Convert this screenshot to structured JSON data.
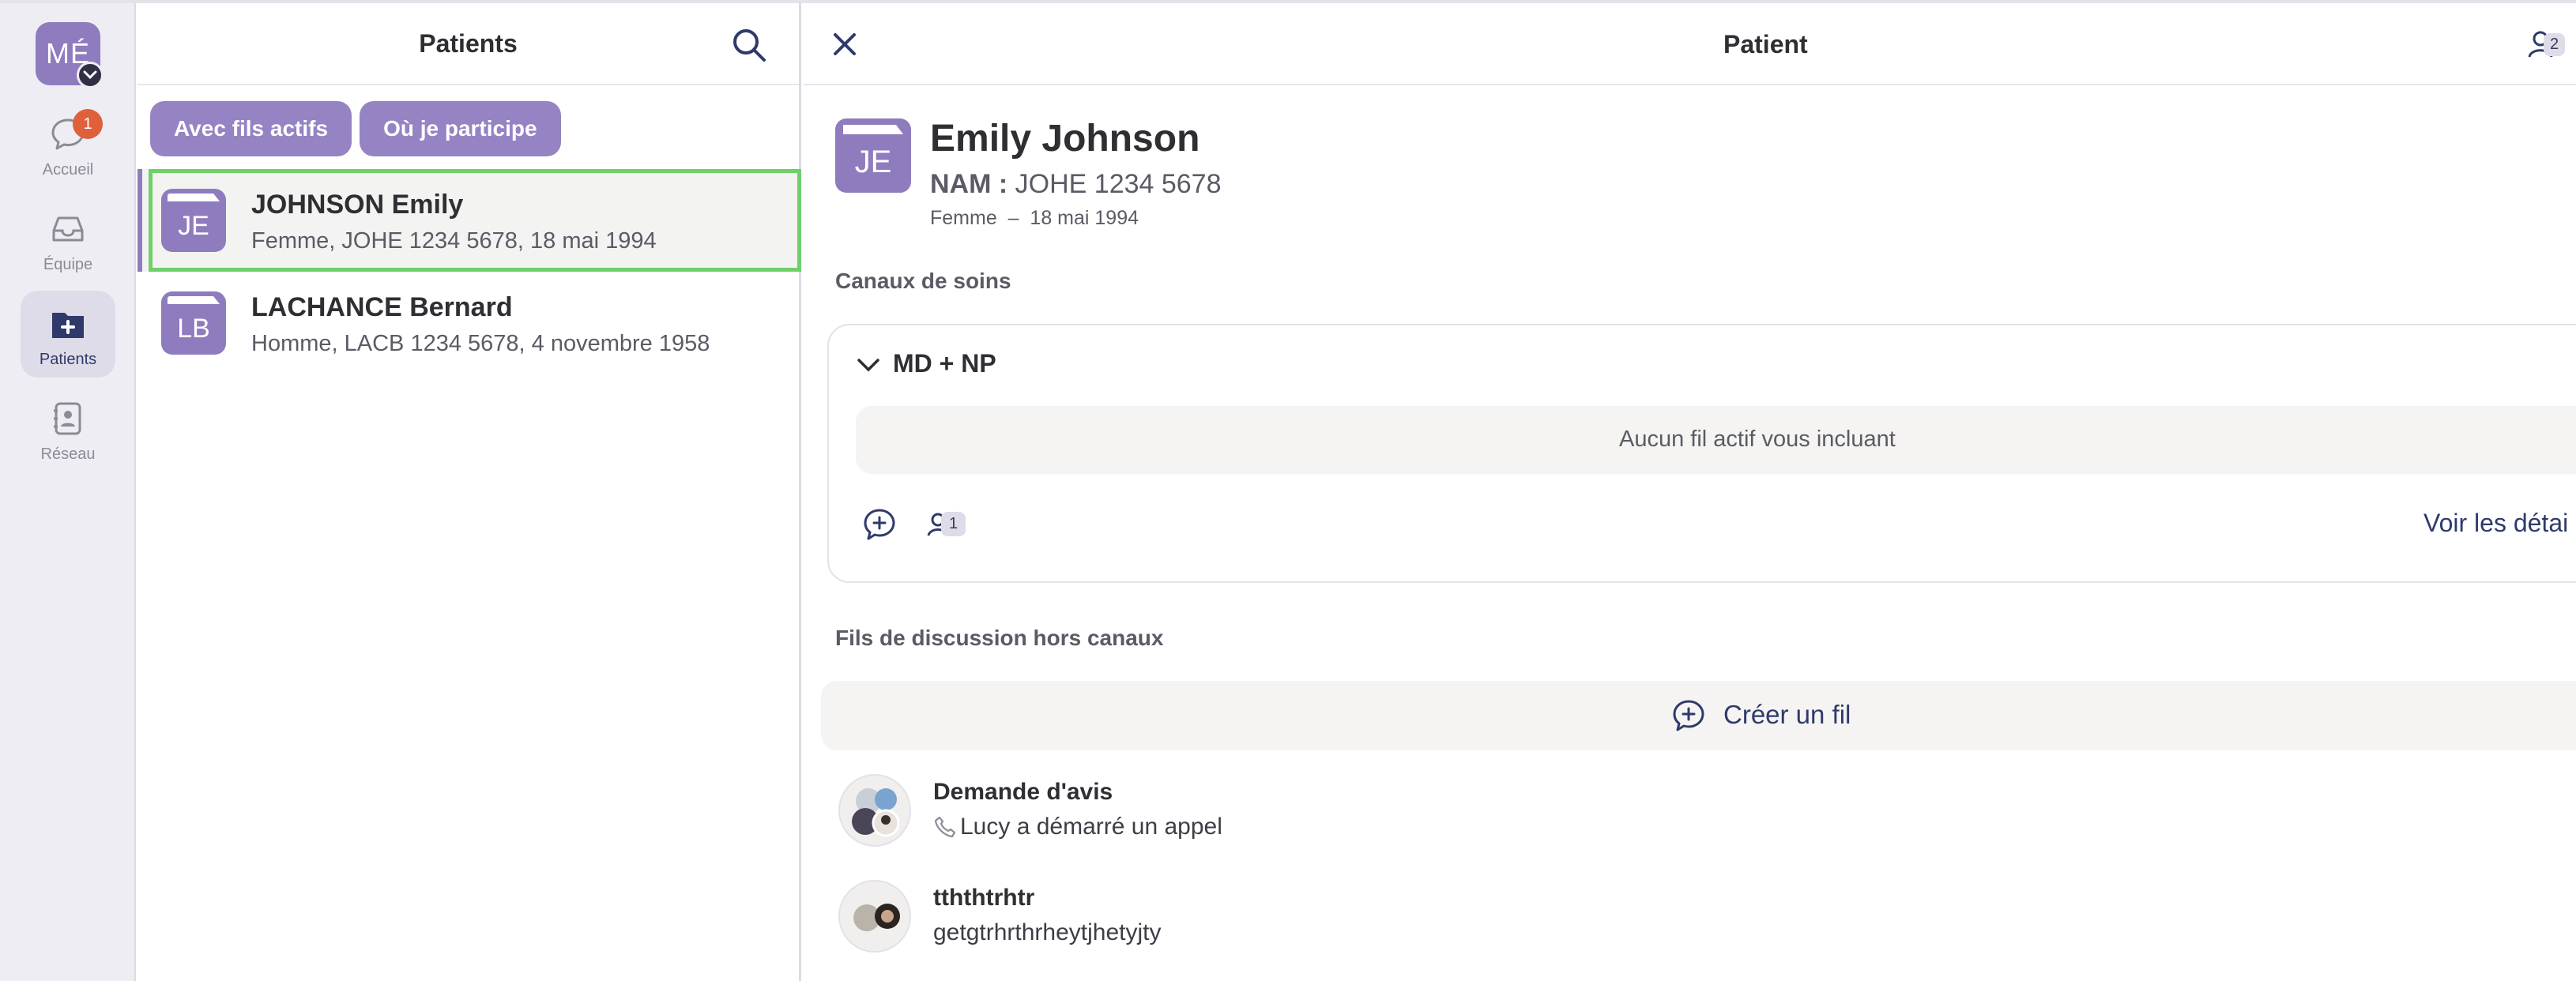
{
  "rail": {
    "user_initials": "MÉ",
    "items": [
      {
        "label": "Accueil",
        "icon": "chat-bubble-icon",
        "badge": "1"
      },
      {
        "label": "Équipe",
        "icon": "inbox-icon"
      },
      {
        "label": "Patients",
        "icon": "patient-folder-icon",
        "active": true
      },
      {
        "label": "Réseau",
        "icon": "contact-book-icon"
      }
    ]
  },
  "list": {
    "title": "Patients",
    "filters": [
      "Avec fils actifs",
      "Où je participe"
    ],
    "patients": [
      {
        "initials": "JE",
        "name": "JOHNSON Emily",
        "sub": "Femme, JOHE 1234 5678, 18 mai 1994"
      },
      {
        "initials": "LB",
        "name": "LACHANCE Bernard",
        "sub": "Homme, LACB 1234 5678, 4 novembre 1958"
      }
    ]
  },
  "detail": {
    "title": "Patient",
    "members_count": "2",
    "initials": "JE",
    "name": "Emily Johnson",
    "nam_label": "NAM :",
    "nam_value": "JOHE 1234 5678",
    "meta": "Femme  –  18 mai 1994",
    "canaux_label": "Canaux de soins",
    "canal": {
      "title": "MD + NP",
      "empty_text": "Aucun fil actif vous incluant",
      "participant_count": "1",
      "details_link": "Voir les détai"
    },
    "hors_canaux_label": "Fils de discussion hors canaux",
    "create_label": "Créer un fil",
    "threads": [
      {
        "title": "Demande d'avis",
        "sub": "Lucy a démarré un appel"
      },
      {
        "title": "tththtrhtr",
        "sub": "getgtrhrthrheytjhetyjty"
      }
    ]
  },
  "colors": {
    "accent": "#8f7cbf",
    "chip": "#9583c3",
    "badge": "#e0603b",
    "selection_outline": "#6fd06a",
    "link": "#2f3a6b"
  }
}
